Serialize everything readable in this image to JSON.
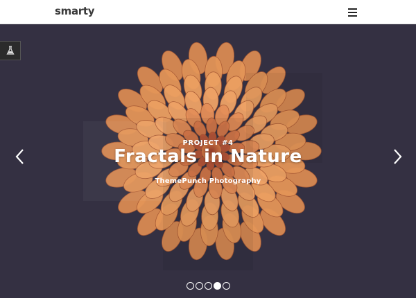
{
  "header": {
    "logo": "smarty",
    "menu_icon": "hamburger-menu-icon"
  },
  "slider": {
    "background": "#343042",
    "accent": "#e9955a",
    "side_tab_icon": "flask-icon",
    "prev_icon": "chevron-left-icon",
    "next_icon": "chevron-right-icon",
    "slide": {
      "subtitle": "PROJECT #4",
      "title": "Fractals in Nature",
      "credit": "ThemePunch Photography"
    },
    "bullets": [
      {
        "active": false
      },
      {
        "active": false
      },
      {
        "active": false
      },
      {
        "active": true
      },
      {
        "active": false
      }
    ]
  }
}
